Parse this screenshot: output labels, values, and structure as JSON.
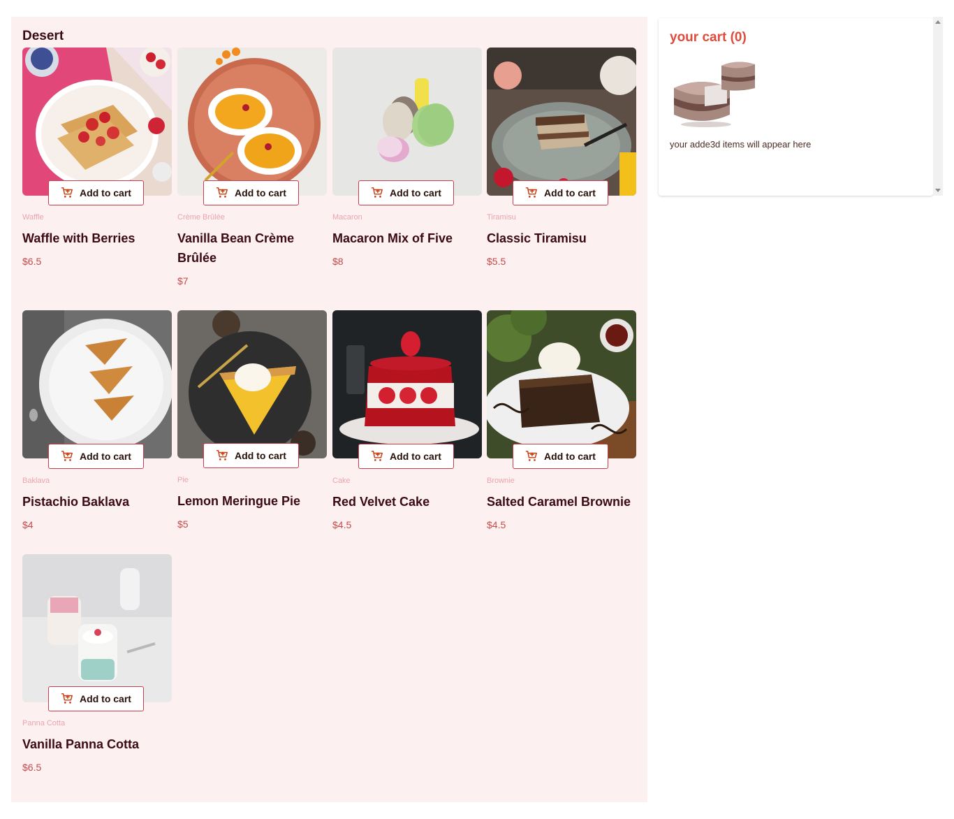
{
  "menu": {
    "title": "Desert",
    "add_label": "Add to cart",
    "items": [
      {
        "category": "Waffle",
        "name": "Waffle with Berries",
        "price": "$6.5"
      },
      {
        "category": "Crème Brûlée",
        "name": "Vanilla Bean Crème Brûlée",
        "price": "$7"
      },
      {
        "category": "Macaron",
        "name": "Macaron Mix of Five",
        "price": "$8"
      },
      {
        "category": "Tiramisu",
        "name": "Classic Tiramisu",
        "price": "$5.5"
      },
      {
        "category": "Baklava",
        "name": "Pistachio Baklava",
        "price": "$4"
      },
      {
        "category": "Pie",
        "name": "Lemon Meringue Pie",
        "price": "$5"
      },
      {
        "category": "Cake",
        "name": "Red Velvet Cake",
        "price": "$4.5"
      },
      {
        "category": "Brownie",
        "name": "Salted Caramel Brownie",
        "price": "$4.5"
      },
      {
        "category": "Panna Cotta",
        "name": "Vanilla Panna Cotta",
        "price": "$6.5"
      }
    ]
  },
  "cart": {
    "title": "your cart (0)",
    "empty_message": "your adde3d items will appear here"
  },
  "colors": {
    "accent": "#c73b0f",
    "background": "#fdf0f0",
    "title": "#3b0a14",
    "price": "#c54a4a"
  },
  "icons": {
    "add_to_cart": "cart-plus-icon",
    "empty_cart": "cake-illustration"
  }
}
